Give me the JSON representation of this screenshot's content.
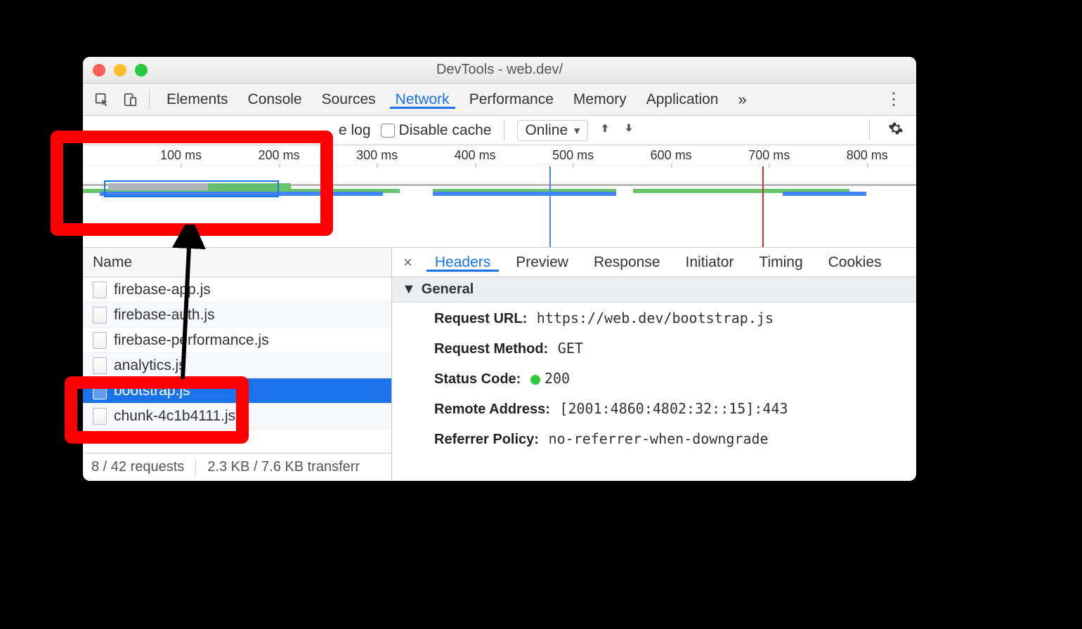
{
  "window": {
    "title": "DevTools - web.dev/"
  },
  "tabs": {
    "items": [
      "Elements",
      "Console",
      "Sources",
      "Network",
      "Performance",
      "Memory",
      "Application"
    ],
    "active": "Network"
  },
  "filter": {
    "preserve_log_label": "e log",
    "disable_cache_label": "Disable cache",
    "throttle_value": "Online"
  },
  "timeline": {
    "ticks": [
      "100 ms",
      "200 ms",
      "300 ms",
      "400 ms",
      "500 ms",
      "600 ms",
      "700 ms",
      "800 ms"
    ]
  },
  "requests": {
    "header": "Name",
    "items": [
      {
        "name": "firebase-app.js",
        "selected": false
      },
      {
        "name": "firebase-auth.js",
        "selected": false
      },
      {
        "name": "firebase-performance.js",
        "selected": false
      },
      {
        "name": "analytics.js",
        "selected": false
      },
      {
        "name": "bootstrap.js",
        "selected": true
      },
      {
        "name": "chunk-4c1b4111.js",
        "selected": false
      }
    ],
    "footer": {
      "count": "8 / 42 requests",
      "transfer": "2.3 KB / 7.6 KB transferr"
    }
  },
  "details": {
    "tabs": [
      "Headers",
      "Preview",
      "Response",
      "Initiator",
      "Timing",
      "Cookies"
    ],
    "active": "Headers",
    "general_label": "General",
    "general": {
      "request_url": {
        "k": "Request URL:",
        "v": "https://web.dev/bootstrap.js"
      },
      "request_method": {
        "k": "Request Method:",
        "v": "GET"
      },
      "status_code": {
        "k": "Status Code:",
        "v": "200"
      },
      "remote_address": {
        "k": "Remote Address:",
        "v": "[2001:4860:4802:32::15]:443"
      },
      "referrer_policy": {
        "k": "Referrer Policy:",
        "v": "no-referrer-when-downgrade"
      }
    }
  }
}
